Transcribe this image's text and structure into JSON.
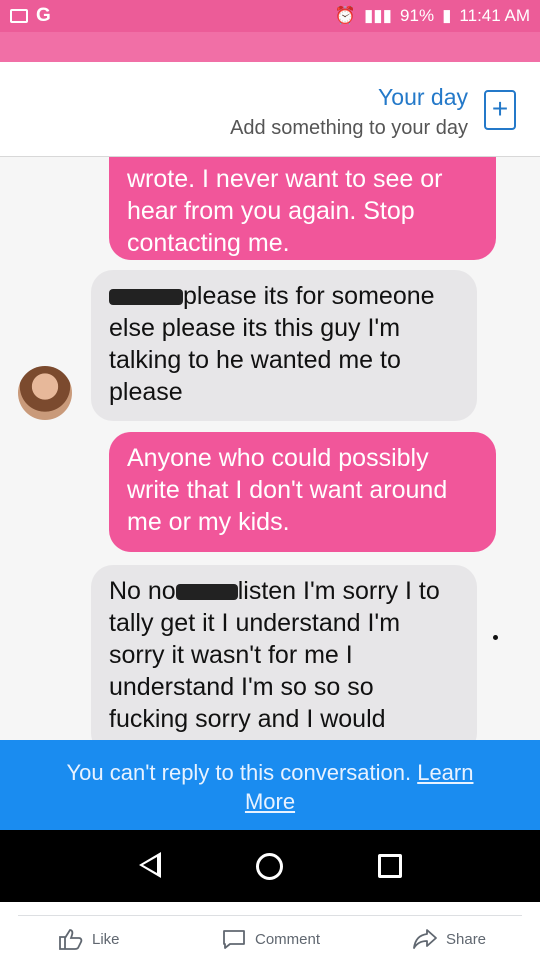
{
  "status_bar": {
    "battery": "91%",
    "time": "11:41 AM",
    "icons": [
      "image-icon",
      "g-icon",
      "alarm-icon",
      "mute-icon",
      "signal-icon",
      "battery-icon"
    ]
  },
  "your_day": {
    "title": "Your day",
    "subtitle": "Add something to your day",
    "add_symbol": "+"
  },
  "messages": [
    {
      "sender": "me",
      "text": "wrote. I never want to see or hear from you again. Stop contacting me."
    },
    {
      "sender": "them",
      "prefix_redacted": true,
      "text": "please its for someone else please its this guy I'm talking to he wanted me to please"
    },
    {
      "sender": "me",
      "text": "Anyone who could possibly write that I don't want around me or my kids."
    },
    {
      "sender": "them",
      "text_before": "No no",
      "text_after": "listen I'm sorry I to tally get it I understand I'm sorry it wasn't for me I understand I'm so so so fucking sorry and I would"
    }
  ],
  "banner": {
    "text": "You can't reply to this conversation. ",
    "link": "Learn More"
  },
  "actions": {
    "like": "Like",
    "comment": "Comment",
    "share": "Share"
  },
  "colors": {
    "pink_header": "#f16fa6",
    "outgoing_bubble": "#f1569a",
    "incoming_bubble": "#e7e6e8",
    "banner_blue": "#1a8cf0",
    "link_blue": "#2479c9"
  }
}
